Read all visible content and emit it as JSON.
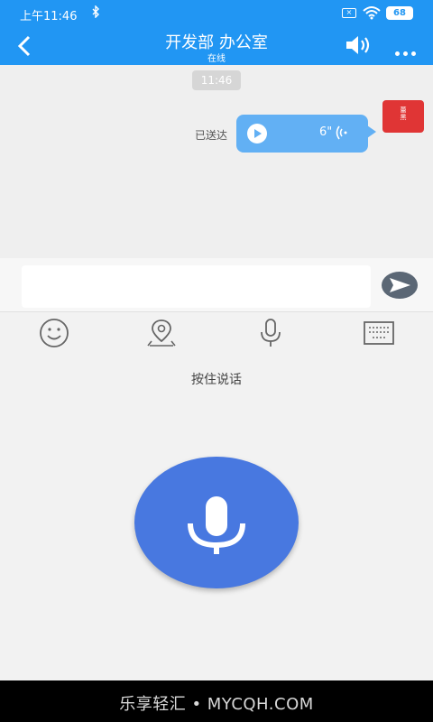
{
  "status_bar": {
    "time": "上午11:46",
    "battery": "68",
    "sim_icon": "sim-x-icon",
    "colors": {
      "bar": "#2196f3"
    }
  },
  "header": {
    "title": "开发部 办公室",
    "subtitle": "在线"
  },
  "chat": {
    "timestamp": "11:46",
    "message": {
      "status": "已送达",
      "duration": "6\"",
      "avatar_text": "蕾\n黑",
      "avatar_color": "#e03535",
      "bubble_color": "#62b0f4"
    }
  },
  "composer": {
    "input_value": "",
    "send_icon": "send-icon"
  },
  "toolbar": {
    "icons": [
      "emoji-icon",
      "location-icon",
      "microphone-icon",
      "keyboard-icon"
    ]
  },
  "voice_panel": {
    "hint": "按住说话",
    "button_color": "#4878e0"
  },
  "nav_bar": {
    "watermark": "乐享轻汇 • MYCQH.COM"
  }
}
